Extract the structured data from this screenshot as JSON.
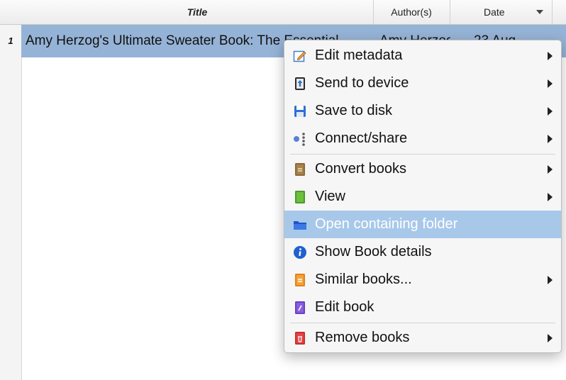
{
  "table": {
    "columns": {
      "title": "Title",
      "author": "Author(s)",
      "date": "Date"
    },
    "rows": [
      {
        "number": "1",
        "title": "Amy Herzog's Ultimate Sweater Book: The Essential",
        "author": "Amy Herzog",
        "date": "23 Aug"
      }
    ]
  },
  "context_menu": {
    "items": [
      {
        "label": "Edit metadata",
        "icon": "edit-metadata-icon",
        "submenu": true
      },
      {
        "label": "Send to device",
        "icon": "send-to-device-icon",
        "submenu": true
      },
      {
        "label": "Save to disk",
        "icon": "save-to-disk-icon",
        "submenu": true
      },
      {
        "label": "Connect/share",
        "icon": "connect-share-icon",
        "submenu": true
      },
      {
        "label": "Convert books",
        "icon": "convert-books-icon",
        "submenu": true
      },
      {
        "label": "View",
        "icon": "view-icon",
        "submenu": true
      },
      {
        "label": "Open containing folder",
        "icon": "folder-icon",
        "submenu": false,
        "highlighted": true
      },
      {
        "label": "Show Book details",
        "icon": "info-icon",
        "submenu": false
      },
      {
        "label": "Similar books...",
        "icon": "similar-books-icon",
        "submenu": true
      },
      {
        "label": "Edit book",
        "icon": "edit-book-icon",
        "submenu": false
      },
      {
        "label": "Remove books",
        "icon": "trash-icon",
        "submenu": true
      }
    ]
  },
  "colors": {
    "selection": "#95b3d6",
    "menu_highlight": "#a8c8ea",
    "menu_background": "#f6f6f6"
  }
}
